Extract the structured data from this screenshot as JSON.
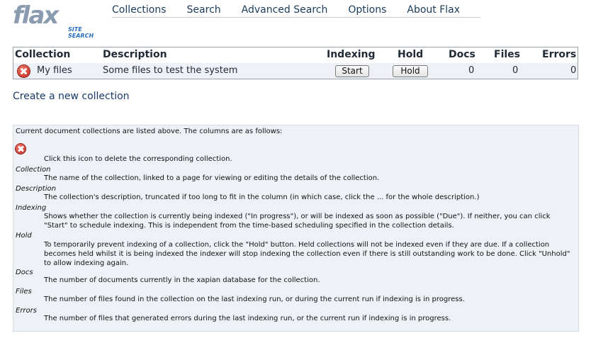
{
  "logo": {
    "main": "flax",
    "subtitle": "SITE SEARCH"
  },
  "nav": [
    "Collections",
    "Search",
    "Advanced Search",
    "Options",
    "About Flax"
  ],
  "table": {
    "headers": {
      "collection": "Collection",
      "description": "Description",
      "indexing": "Indexing",
      "hold": "Hold",
      "docs": "Docs",
      "files": "Files",
      "errors": "Errors"
    },
    "rows": [
      {
        "name": "My files",
        "description": "Some files to test the system",
        "indexing_button": "Start",
        "hold_button": "Hold",
        "docs": "0",
        "files": "0",
        "errors": "0"
      }
    ]
  },
  "create_link": "Create a new collection",
  "help": {
    "intro": "Current document collections are listed above. The columns are as follows:",
    "delete_desc": "Click this icon to delete the corresponding collection.",
    "items": [
      {
        "term": "Collection",
        "desc": "The name of the collection, linked to a page for viewing or editing the details of the collection."
      },
      {
        "term": "Description",
        "desc": "The collection's description, truncated if too long to fit in the column (in which case, click the ... for the whole description.)"
      },
      {
        "term": "Indexing",
        "desc": "Shows whether the collection is currently being indexed (\"In progress\"), or will be indexed as soon as possible (\"Due\"). If neither, you can click \"Start\" to schedule indexing. This is independent from the time-based scheduling specified in the collection details."
      },
      {
        "term": "Hold",
        "desc": "To temporarily prevent indexing of a collection, click the \"Hold\" button. Held collections will not be indexed even if they are due. If a collection becomes held whilst it is being indexed the indexer will stop indexing the collection even if there is still outstanding work to be done. Click \"Unhold\" to allow indexing again."
      },
      {
        "term": "Docs",
        "desc": "The number of documents currently in the xapian database for the collection."
      },
      {
        "term": "Files",
        "desc": "The number of files found in the collection on the last indexing run, or during the current run if indexing is in progress."
      },
      {
        "term": "Errors",
        "desc": "The number of files that generated errors during the last indexing run, or the current run if indexing is in progress."
      }
    ]
  },
  "colors": {
    "accent": "#2a6fbf",
    "row_bg": "#eef1f6",
    "delete": "#c0241a"
  },
  "icons": [
    "delete-collection-icon"
  ]
}
